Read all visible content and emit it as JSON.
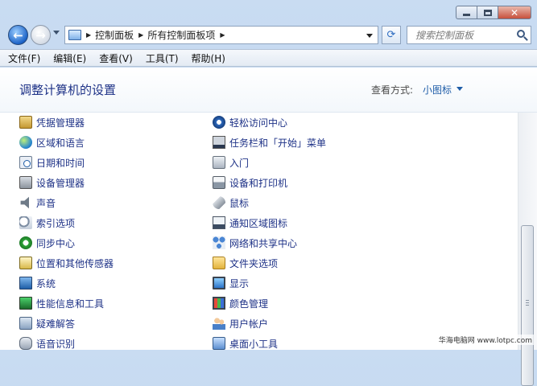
{
  "window": {
    "caption": {
      "minimize": "",
      "maximize": "",
      "close": "✕"
    }
  },
  "nav": {
    "back_glyph": "←",
    "forward_glyph": "→",
    "breadcrumbs": [
      "控制面板",
      "所有控制面板项"
    ],
    "refresh_glyph": "⟳",
    "search_placeholder": "搜索控制面板"
  },
  "menu": [
    "文件(F)",
    "编辑(E)",
    "查看(V)",
    "工具(T)",
    "帮助(H)"
  ],
  "content": {
    "title": "调整计算机的设置",
    "view_by_label": "查看方式:",
    "view_by_value": "小图标"
  },
  "items_left": [
    {
      "label": "凭据管理器",
      "icon": "credential-manager-icon"
    },
    {
      "label": "区域和语言",
      "icon": "region-language-icon"
    },
    {
      "label": "日期和时间",
      "icon": "date-time-icon"
    },
    {
      "label": "设备管理器",
      "icon": "device-manager-icon"
    },
    {
      "label": "声音",
      "icon": "sound-icon"
    },
    {
      "label": "索引选项",
      "icon": "indexing-options-icon"
    },
    {
      "label": "同步中心",
      "icon": "sync-center-icon"
    },
    {
      "label": "位置和其他传感器",
      "icon": "location-sensors-icon"
    },
    {
      "label": "系统",
      "icon": "system-icon"
    },
    {
      "label": "性能信息和工具",
      "icon": "performance-icon"
    },
    {
      "label": "疑难解答",
      "icon": "troubleshooting-icon"
    },
    {
      "label": "语音识别",
      "icon": "speech-recognition-icon"
    }
  ],
  "items_right": [
    {
      "label": "轻松访问中心",
      "icon": "ease-of-access-icon"
    },
    {
      "label": "任务栏和「开始」菜单",
      "icon": "taskbar-start-menu-icon"
    },
    {
      "label": "入门",
      "icon": "getting-started-icon"
    },
    {
      "label": "设备和打印机",
      "icon": "devices-printers-icon"
    },
    {
      "label": "鼠标",
      "icon": "mouse-icon"
    },
    {
      "label": "通知区域图标",
      "icon": "notification-area-icon"
    },
    {
      "label": "网络和共享中心",
      "icon": "network-sharing-icon"
    },
    {
      "label": "文件夹选项",
      "icon": "folder-options-icon"
    },
    {
      "label": "显示",
      "icon": "display-icon"
    },
    {
      "label": "颜色管理",
      "icon": "color-management-icon"
    },
    {
      "label": "用户帐户",
      "icon": "user-accounts-icon"
    },
    {
      "label": "桌面小工具",
      "icon": "desktop-gadgets-icon"
    }
  ],
  "watermark": "华海电脑网 www.lotpc.com"
}
